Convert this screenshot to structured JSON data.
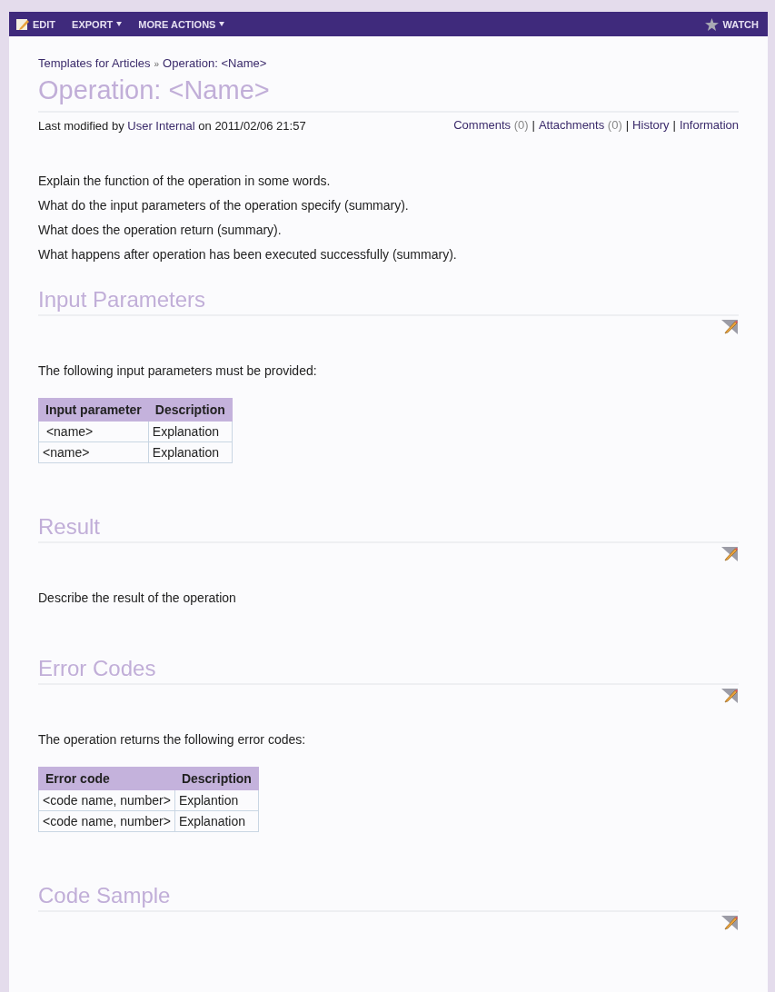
{
  "toolbar": {
    "actions": [
      {
        "label": "EDIT",
        "kind": "edit"
      },
      {
        "label": "EXPORT",
        "kind": "menu"
      },
      {
        "label": "MORE ACTIONS",
        "kind": "menu"
      }
    ],
    "watch": {
      "label": "WATCH"
    }
  },
  "breadcrumb": [
    {
      "label": "Templates for Articles"
    },
    {
      "label": "»",
      "kind": "separator"
    },
    {
      "label": "Operation: <Name>"
    }
  ],
  "title": "Operation: <Name>",
  "meta": {
    "prefix": "Last modified by",
    "author": "User Internal",
    "date": "on 2011/02/06 21:57",
    "links": [
      {
        "label": "Comments",
        "count": "(0)"
      },
      {
        "label": "|",
        "kind": "separator"
      },
      {
        "label": "Attachments",
        "count": "(0)"
      },
      {
        "label": "|",
        "kind": "separator"
      },
      {
        "label": "History"
      },
      {
        "label": "|",
        "kind": "separator"
      },
      {
        "label": "Information"
      }
    ]
  },
  "intro": [
    "Explain the function of the operation in some words.",
    "What do the input parameters of the operation specify (summary).",
    "What does the operation return (summary).",
    "What happens after operation has been executed successfully (summary)."
  ],
  "sections": [
    {
      "heading": "Input Parameters",
      "content": [
        {
          "kind": "paragraph",
          "text": "The following input parameters must be provided:"
        },
        {
          "kind": "table",
          "columns": [
            "Input parameter",
            "Description"
          ],
          "rows": [
            [
              " <name>",
              "Explanation"
            ],
            [
              "<name>",
              "Explanation"
            ]
          ]
        }
      ]
    },
    {
      "heading": "Result",
      "content": [
        {
          "kind": "paragraph",
          "text": "Describe the result of the operation"
        }
      ]
    },
    {
      "heading": "Error Codes",
      "content": [
        {
          "kind": "paragraph",
          "text": "The operation returns the following error codes:"
        },
        {
          "kind": "table",
          "columns": [
            "Error code",
            "Description"
          ],
          "rows": [
            [
              "<code name, number>",
              "Explantion"
            ],
            [
              "<code name, number>",
              "Explanation"
            ]
          ]
        }
      ]
    },
    {
      "heading": "Code Sample"
    }
  ]
}
